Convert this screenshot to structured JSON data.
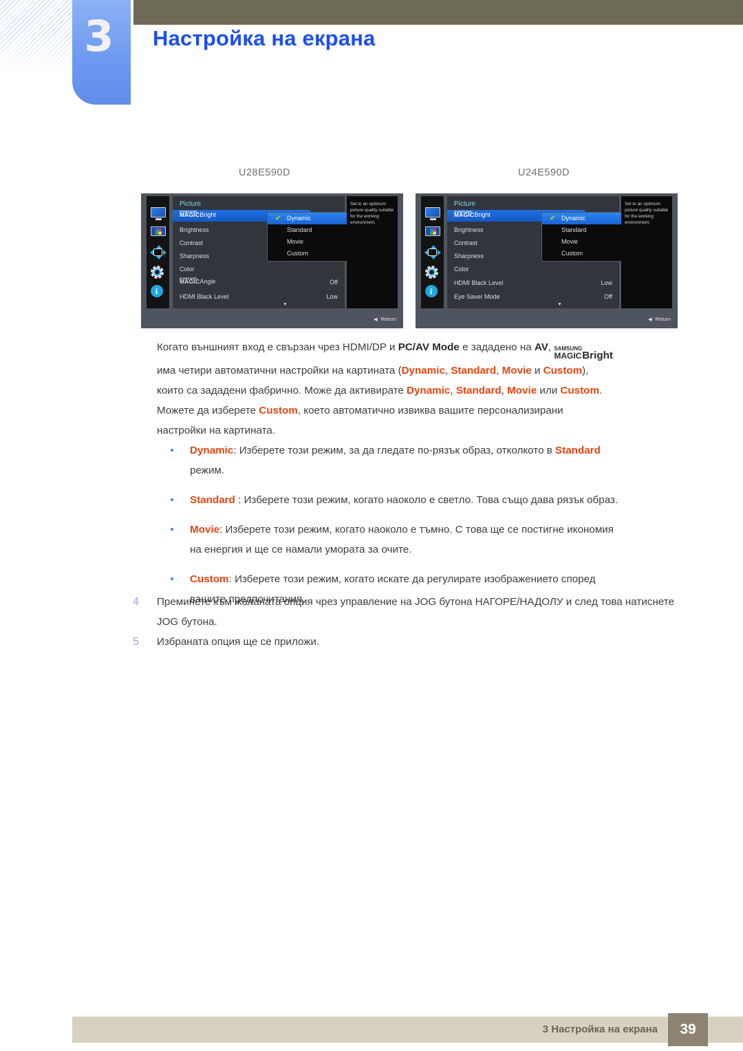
{
  "header": {
    "chapter_number": "3",
    "chapter_title": "Настройка на екрана"
  },
  "models": {
    "left_caption": "U28E590D",
    "right_caption": "U24E590D"
  },
  "osd_left": {
    "title": "Picture",
    "sidebar_icons": [
      "monitor-icon",
      "picture-icon",
      "onscreen-display-icon",
      "system-gear-icon",
      "information-icon"
    ],
    "items": [
      {
        "label_prefix": "SAMSUNG",
        "label_magic": "MAGIC",
        "label_suffix": "Bright",
        "value": "",
        "selected": true
      },
      {
        "label": "Brightness",
        "value": "",
        "selected": false
      },
      {
        "label": "Contrast",
        "value": "",
        "selected": false
      },
      {
        "label": "Sharpness",
        "value": "",
        "selected": false
      },
      {
        "label": "Color",
        "value": "",
        "selected": false
      },
      {
        "label_prefix": "SAMSUNG",
        "label_magic": "MAGIC",
        "label_suffix": "Angle",
        "value": "Off",
        "selected": false
      },
      {
        "label": "HDMI Black Level",
        "value": "Low",
        "selected": false
      }
    ],
    "submenu": [
      {
        "label": "Dynamic",
        "checked": true,
        "selected": true
      },
      {
        "label": "Standard",
        "checked": false,
        "selected": false
      },
      {
        "label": "Movie",
        "checked": false,
        "selected": false
      },
      {
        "label": "Custom",
        "checked": false,
        "selected": false
      }
    ],
    "description": "Set to an optimum picture quality suitable for the working environment.",
    "return_label": "Return",
    "scroll_indicator": "▼"
  },
  "osd_right": {
    "title": "Picture",
    "sidebar_icons": [
      "monitor-icon",
      "picture-icon",
      "onscreen-display-icon",
      "system-gear-icon",
      "information-icon"
    ],
    "items": [
      {
        "label_prefix": "SAMSUNG",
        "label_magic": "MAGIC",
        "label_suffix": "Bright",
        "value": "",
        "selected": true
      },
      {
        "label": "Brightness",
        "value": "",
        "selected": false
      },
      {
        "label": "Contrast",
        "value": "",
        "selected": false
      },
      {
        "label": "Sharpness",
        "value": "",
        "selected": false
      },
      {
        "label": "Color",
        "value": "",
        "selected": false
      },
      {
        "label": "HDMI Black Level",
        "value": "Low",
        "selected": false
      },
      {
        "label": "Eye Saver Mode",
        "value": "Off",
        "selected": false
      }
    ],
    "submenu": [
      {
        "label": "Dynamic",
        "checked": true,
        "selected": true
      },
      {
        "label": "Standard",
        "checked": false,
        "selected": false
      },
      {
        "label": "Movie",
        "checked": false,
        "selected": false
      },
      {
        "label": "Custom",
        "checked": false,
        "selected": false
      }
    ],
    "description": "Set to an optimum picture quality suitable for the working environment.",
    "return_label": "Return",
    "scroll_indicator": "▼"
  },
  "body": {
    "intro": {
      "p1a": "Когато външният вход е свързан чрез HDMI/DP и ",
      "p1b": "PC/AV Mode",
      "p1c": " е зададено на ",
      "p1d": "AV",
      "p1e": ", ",
      "magic_samsung": "SAMSUNG",
      "magic_magic": "MAGIC",
      "magic_suffix": "Bright",
      "p2a": "има четири автоматични настройки на картината (",
      "t_dynamic": "Dynamic",
      "p2b": ", ",
      "t_standard": "Standard",
      "p2c": ", ",
      "t_movie": "Movie",
      "p2d": " и ",
      "t_custom": "Custom",
      "p2e": "),",
      "p3a": "които са зададени фабрично. Може да активирате ",
      "p3b": ", ",
      "p3c": ", ",
      "p3d": " или ",
      "p3e": ".",
      "p4a": "Можете да изберете ",
      "p4b": ", което автоматично извиква вашите персонализирани",
      "p5": "настройки на картината."
    },
    "bullets": [
      {
        "term": "Dynamic",
        "text_before": ": Изберете този режим, за да гледате по-рязък образ, отколкото в ",
        "term2": "Standard",
        "text_after": "",
        "line2": "режим."
      },
      {
        "term": "Standard",
        "text_before": " : Изберете този режим, когато наоколо е светло. Това също дава рязък образ.",
        "term2": "",
        "text_after": "",
        "line2": ""
      },
      {
        "term": "Movie",
        "text_before": ": Изберете този режим, когато наоколо е тъмно. С това ще се постигне икономия",
        "term2": "",
        "text_after": "",
        "line2": "на енергия и ще се намали умората за очите."
      },
      {
        "term": "Custom",
        "text_before": ": Изберете този режим, когато искате да регулирате изображението според",
        "term2": "",
        "text_after": "",
        "line2": "вашите предпочитания."
      }
    ],
    "steps": [
      {
        "number": "4",
        "text": "Преминете към желаната опция чрез управление на JOG бутона НАГОРЕ/НАДОЛУ и след това натиснете JOG бутона."
      },
      {
        "number": "5",
        "text": "Избраната опция ще се приложи."
      }
    ]
  },
  "footer": {
    "text": "3 Настройка на екрана",
    "page_number": "39"
  },
  "colors": {
    "olive": "#6d6a56",
    "chapter_blue": "#1c4ff0",
    "tab_blue": "#6e9bf0",
    "orange": "#e8440d",
    "footer_bg": "#d6d2bf",
    "page_box": "#8e8372"
  }
}
